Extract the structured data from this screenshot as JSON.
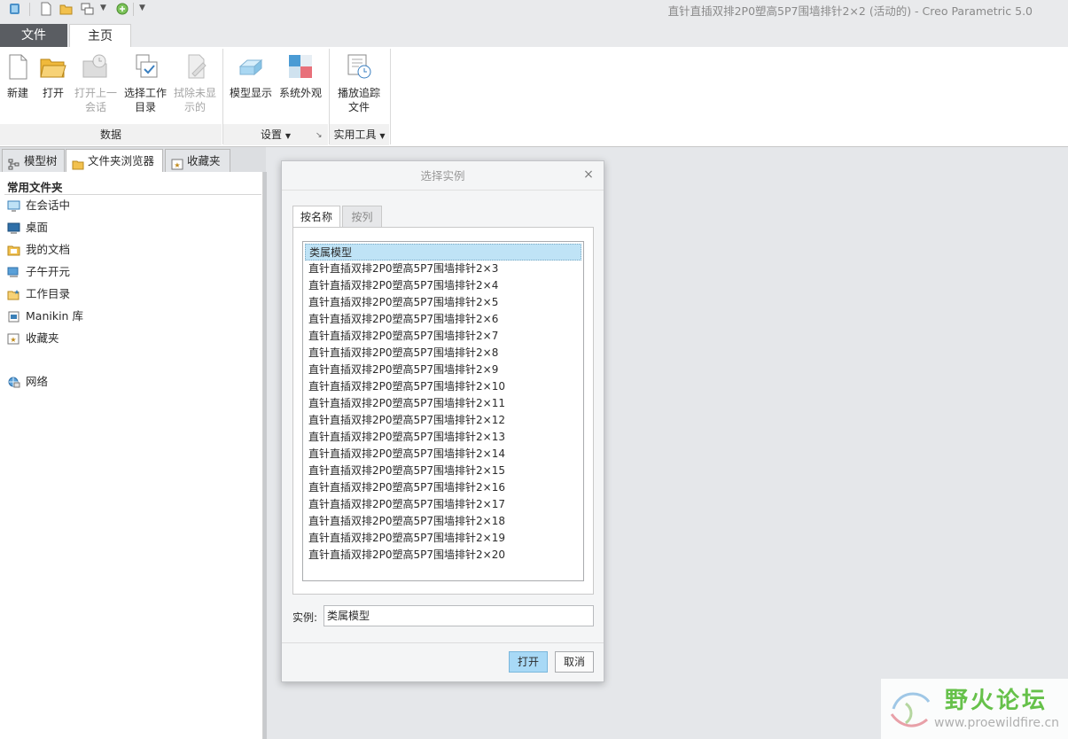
{
  "window": {
    "title": "直针直插双排2P0塑高5P7围墙排针2×2 (活动的) - Creo Parametric 5.0"
  },
  "quick_access": [
    "app-icon",
    "new-icon",
    "open-icon",
    "windows-icon",
    "dropdown-icon",
    "regenerate-icon",
    "customize-icon"
  ],
  "ribbon_tabs": {
    "file": "文件",
    "home": "主页"
  },
  "ribbon": {
    "data_group": {
      "label": "数据",
      "new": "新建",
      "open": "打开",
      "open_last_session": "打开上一会话",
      "select_working_dir": "选择工作目录",
      "erase_not_displayed": "拭除未显示的"
    },
    "settings_group": {
      "label": "设置",
      "model_display": "模型显示",
      "system_appearance": "系统外观"
    },
    "utilities_group": {
      "label": "实用工具",
      "play_trail": "播放追踪文件"
    }
  },
  "left_tabs": {
    "model_tree": "模型树",
    "folder_browser": "文件夹浏览器",
    "favorites": "收藏夹"
  },
  "folders": {
    "heading": "常用文件夹",
    "items": [
      {
        "label": "在会话中",
        "icon": "monitor-icon"
      },
      {
        "label": "桌面",
        "icon": "desktop-icon"
      },
      {
        "label": "我的文档",
        "icon": "documents-icon"
      },
      {
        "label": "子午开元",
        "icon": "computer-icon"
      },
      {
        "label": "工作目录",
        "icon": "working-dir-icon"
      },
      {
        "label": "Manikin 库",
        "icon": "library-icon"
      },
      {
        "label": "收藏夹",
        "icon": "favorites-icon"
      },
      {
        "label": "网络",
        "icon": "network-icon"
      }
    ]
  },
  "dialog": {
    "title": "选择实例",
    "close": "×",
    "tab_by_name": "按名称",
    "tab_by_column": "按列",
    "instances": [
      "类属模型",
      "直针直插双排2P0塑高5P7围墙排针2×3",
      "直针直插双排2P0塑高5P7围墙排针2×4",
      "直针直插双排2P0塑高5P7围墙排针2×5",
      "直针直插双排2P0塑高5P7围墙排针2×6",
      "直针直插双排2P0塑高5P7围墙排针2×7",
      "直针直插双排2P0塑高5P7围墙排针2×8",
      "直针直插双排2P0塑高5P7围墙排针2×9",
      "直针直插双排2P0塑高5P7围墙排针2×10",
      "直针直插双排2P0塑高5P7围墙排针2×11",
      "直针直插双排2P0塑高5P7围墙排针2×12",
      "直针直插双排2P0塑高5P7围墙排针2×13",
      "直针直插双排2P0塑高5P7围墙排针2×14",
      "直针直插双排2P0塑高5P7围墙排针2×15",
      "直针直插双排2P0塑高5P7围墙排针2×16",
      "直针直插双排2P0塑高5P7围墙排针2×17",
      "直针直插双排2P0塑高5P7围墙排针2×18",
      "直针直插双排2P0塑高5P7围墙排针2×19",
      "直针直插双排2P0塑高5P7围墙排针2×20"
    ],
    "selected_index": 0,
    "instance_label": "实例:",
    "instance_value": "类属模型",
    "open_button": "打开",
    "cancel_button": "取消"
  },
  "watermark": {
    "brand": "野火论坛",
    "url": "www.proewildfire.cn"
  },
  "colors": {
    "selection": "#bfe3f6",
    "primary_button": "#a8d9f6",
    "file_tab": "#5a5d62",
    "watermark_green": "#66c14a"
  }
}
